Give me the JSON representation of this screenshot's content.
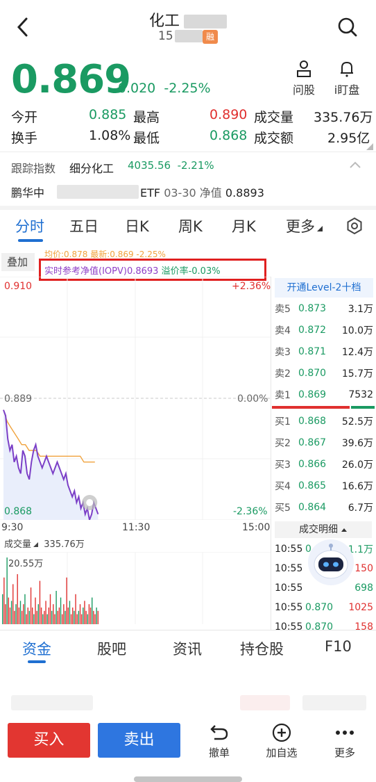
{
  "header": {
    "title": "化工",
    "code_prefix": "15",
    "badge": "融"
  },
  "quote": {
    "price": "0.869",
    "change": "-0.020",
    "change_pct": "-2.25%",
    "tools": [
      "问股",
      "i盯盘"
    ]
  },
  "stats": {
    "row1": [
      {
        "label": "今开",
        "value": "0.885",
        "color": "#1a9a62"
      },
      {
        "label": "最高",
        "value": "0.890",
        "color": "#e0302f"
      },
      {
        "label": "成交量",
        "value": "335.76万",
        "color": "#222222"
      }
    ],
    "row2": [
      {
        "label": "换手",
        "value": "1.08%",
        "color": "#222222"
      },
      {
        "label": "最低",
        "value": "0.868",
        "color": "#1a9a62"
      },
      {
        "label": "成交额",
        "value": "2.95亿",
        "color": "#222222"
      }
    ]
  },
  "tracking": {
    "label": "跟踪指数",
    "index_name": "细分化工",
    "index_value": "4035.56",
    "index_pct": "-2.21%"
  },
  "fund": {
    "name_prefix": "鹏华中",
    "suffix": "ETF",
    "date": "03-30",
    "nav_label": "净值",
    "nav": "0.8893"
  },
  "tabs": [
    "分时",
    "五日",
    "日K",
    "周K",
    "月K",
    "更多"
  ],
  "chart_header": {
    "overlay": "叠加",
    "avg_line": "均价:0.878 最新:0.869 -2.25%",
    "iopv_label": "实时参考净值(IOPV)0.8693",
    "premium": "溢价率-0.03%"
  },
  "chart_data": {
    "type": "line",
    "y_top": "0.910",
    "y_mid": "0.889",
    "y_bottom": "0.868",
    "pct_top": "+2.36%",
    "pct_mid": "0.00%",
    "pct_bottom": "-2.36%",
    "x_ticks": [
      "9:30",
      "11:30",
      "15:00"
    ],
    "ylim": [
      0.868,
      0.91
    ],
    "prev_close": 0.889,
    "series": [
      {
        "name": "最新",
        "color": "#7b3fc7",
        "values": [
          0.887,
          0.886,
          0.882,
          0.88,
          0.881,
          0.878,
          0.879,
          0.877,
          0.876,
          0.88,
          0.879,
          0.876,
          0.875,
          0.878,
          0.88,
          0.881,
          0.879,
          0.878,
          0.877,
          0.878,
          0.879,
          0.878,
          0.877,
          0.876,
          0.877,
          0.878,
          0.877,
          0.876,
          0.875,
          0.876,
          0.874,
          0.873,
          0.872,
          0.873,
          0.871,
          0.872,
          0.87,
          0.871,
          0.869,
          0.87,
          0.868,
          0.869,
          0.871,
          0.87,
          0.869
        ]
      },
      {
        "name": "均价",
        "color": "#f0a23c",
        "values": [
          0.887,
          0.885,
          0.884,
          0.883,
          0.882,
          0.881,
          0.881,
          0.88,
          0.88,
          0.88,
          0.879,
          0.879,
          0.879,
          0.879,
          0.879,
          0.879,
          0.879,
          0.879,
          0.879,
          0.879,
          0.879,
          0.879,
          0.878,
          0.878,
          0.878,
          0.878
        ]
      }
    ],
    "volume_label": "成交量",
    "volume_total": "335.76万",
    "volume_max": "20.55万",
    "volumes": [
      9,
      14,
      6,
      20,
      8,
      5,
      7,
      12,
      4,
      6,
      15,
      5,
      7,
      4,
      6,
      9,
      3,
      5,
      4,
      11,
      5,
      3,
      8,
      4,
      6,
      13,
      5,
      3,
      4,
      7,
      3,
      5,
      9,
      4,
      6,
      3,
      10,
      4,
      5,
      8,
      3,
      6,
      4,
      14,
      5,
      7,
      3,
      5,
      4,
      9,
      3,
      4,
      6,
      3,
      5,
      7,
      4,
      3,
      6,
      5,
      8,
      4,
      3,
      5,
      4
    ]
  },
  "orderbook": {
    "level2": "开通Level-2十档",
    "asks": [
      {
        "label": "卖5",
        "price": "0.873",
        "vol": "3.1万"
      },
      {
        "label": "卖4",
        "price": "0.872",
        "vol": "10.0万"
      },
      {
        "label": "卖3",
        "price": "0.871",
        "vol": "12.4万"
      },
      {
        "label": "卖2",
        "price": "0.870",
        "vol": "15.7万"
      },
      {
        "label": "卖1",
        "price": "0.869",
        "vol": "7532"
      }
    ],
    "bids": [
      {
        "label": "买1",
        "price": "0.868",
        "vol": "52.5万"
      },
      {
        "label": "买2",
        "price": "0.867",
        "vol": "39.6万"
      },
      {
        "label": "买3",
        "price": "0.866",
        "vol": "26.0万"
      },
      {
        "label": "买4",
        "price": "0.865",
        "vol": "16.6万"
      },
      {
        "label": "买5",
        "price": "0.864",
        "vol": "6.7万"
      }
    ]
  },
  "trades": {
    "title": "成交明细",
    "rows": [
      {
        "time": "10:55",
        "price": "0.8",
        "vol": "1.1万",
        "color": "#1a9a62"
      },
      {
        "time": "10:55",
        "price": "",
        "vol": "150",
        "color": "#e0302f"
      },
      {
        "time": "10:55",
        "price": "",
        "vol": "698",
        "color": "#1a9a62"
      },
      {
        "time": "10:55",
        "price": "0.870",
        "vol": "1025",
        "color": "#e0302f"
      },
      {
        "time": "10:55",
        "price": "0.870",
        "vol": "158",
        "color": "#e0302f"
      }
    ]
  },
  "bottom_tabs": [
    "资金",
    "股吧",
    "资讯",
    "持仓股",
    "F10"
  ],
  "actions": {
    "buy": "买入",
    "sell": "卖出",
    "cancel": "撤单",
    "add": "加自选",
    "more": "更多"
  }
}
